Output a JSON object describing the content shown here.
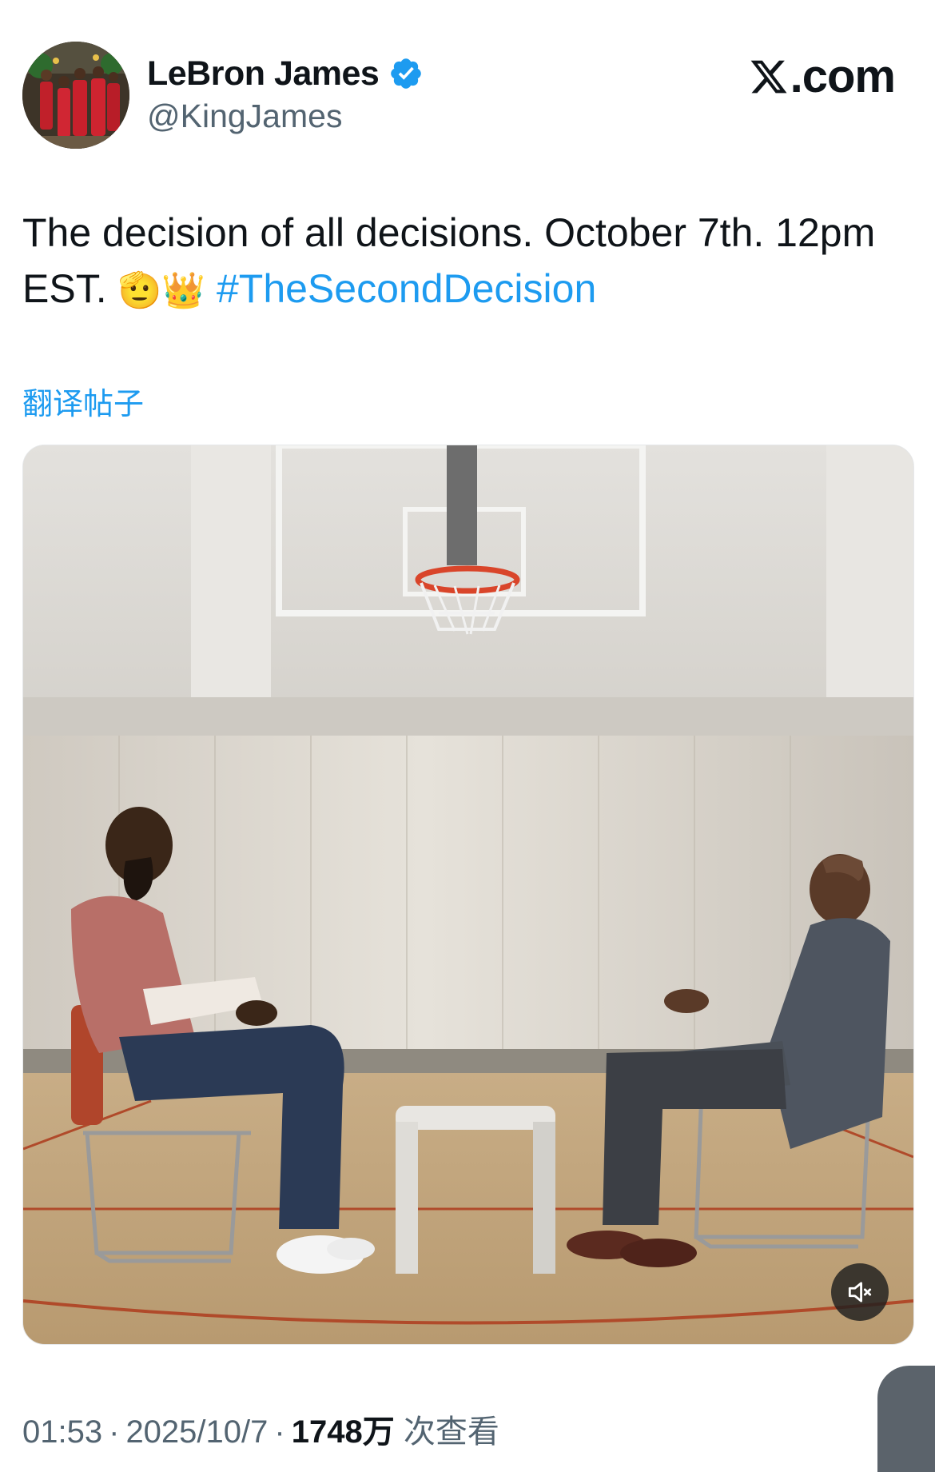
{
  "author": {
    "display_name": "LeBron James",
    "handle": "@KingJames",
    "verified": true
  },
  "site_logo": ".com",
  "tweet": {
    "text_main": "The decision of all decisions. October 7th. 12pm EST. ",
    "emoji": "🫡👑",
    "hashtag": "#TheSecondDecision"
  },
  "translate_label": "翻译帖子",
  "media": {
    "type": "video",
    "icon": "mute-icon"
  },
  "meta": {
    "time": "01:53",
    "date": "2025/10/7",
    "views": "1748万",
    "views_suffix": "次查看"
  },
  "colors": {
    "link": "#1d9bf0",
    "secondary_text": "#536471",
    "primary_text": "#0f1419"
  }
}
